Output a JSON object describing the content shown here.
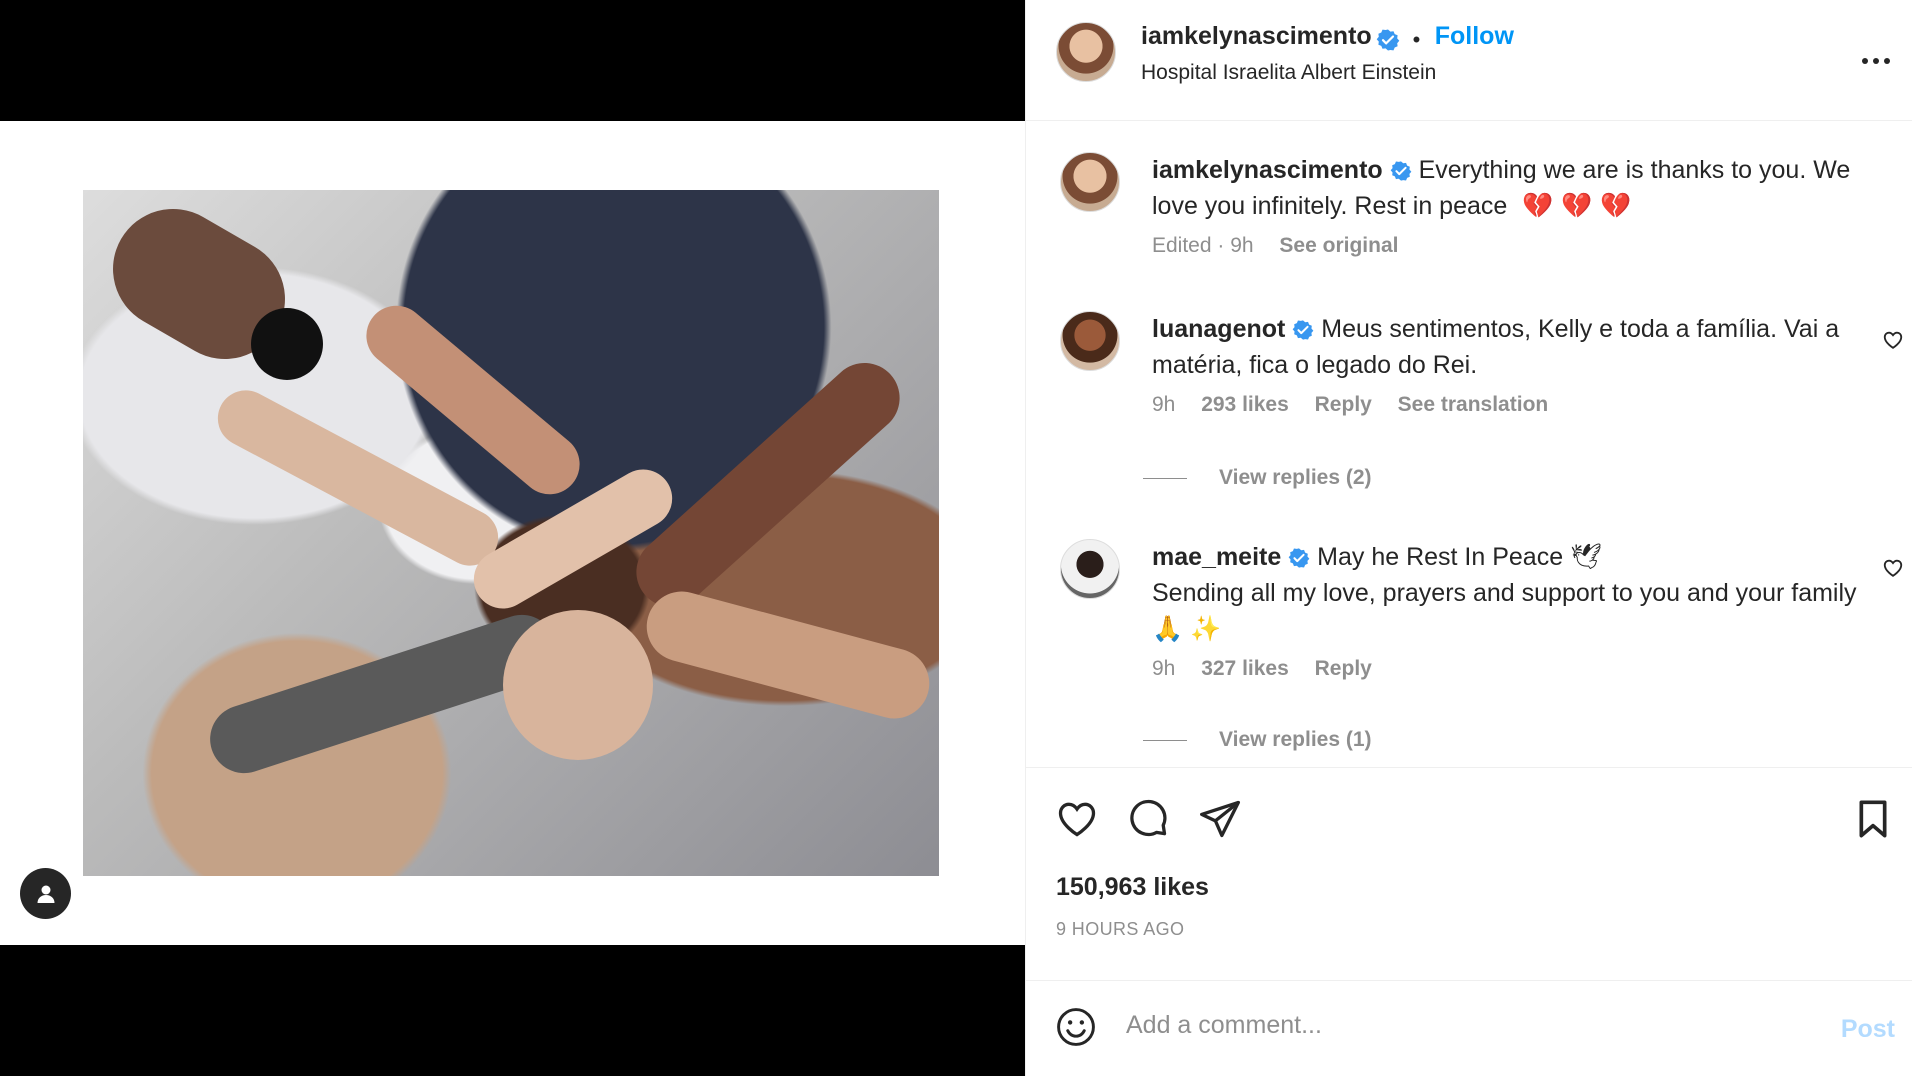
{
  "post": {
    "author": "iamkelynascimento",
    "location": "Hospital Israelita Albert Einstein",
    "follow_label": "Follow",
    "separator": "•"
  },
  "caption": {
    "username": "iamkelynascimento",
    "text": "Everything we are is thanks to you. We love you infinitely. Rest in peace",
    "emoji": "💔 💔 💔",
    "edited": "Edited · 9h",
    "see_original": "See original"
  },
  "comments": [
    {
      "username": "luanagenot",
      "text": "Meus sentimentos, Kelly e toda a família. Vai a matéria, fica o legado do Rei.",
      "time": "9h",
      "likes": "293 likes",
      "reply": "Reply",
      "see_translation": "See translation",
      "view_replies": "View replies (2)"
    },
    {
      "username": "mae_meite",
      "text": "May he Rest In Peace 🕊",
      "text2": "Sending all my love, prayers and support to you and your family 🙏 ✨",
      "time": "9h",
      "likes": "327 likes",
      "reply": "Reply",
      "view_replies": "View replies (1)"
    }
  ],
  "actions": {
    "likes": "150,963 likes",
    "time_ago": "9 HOURS AGO"
  },
  "comment_box": {
    "placeholder": "Add a comment...",
    "post_label": "Post"
  },
  "colors": {
    "link": "#0095f6",
    "muted": "#8e8e8e",
    "post_disabled": "#b3dbff"
  }
}
